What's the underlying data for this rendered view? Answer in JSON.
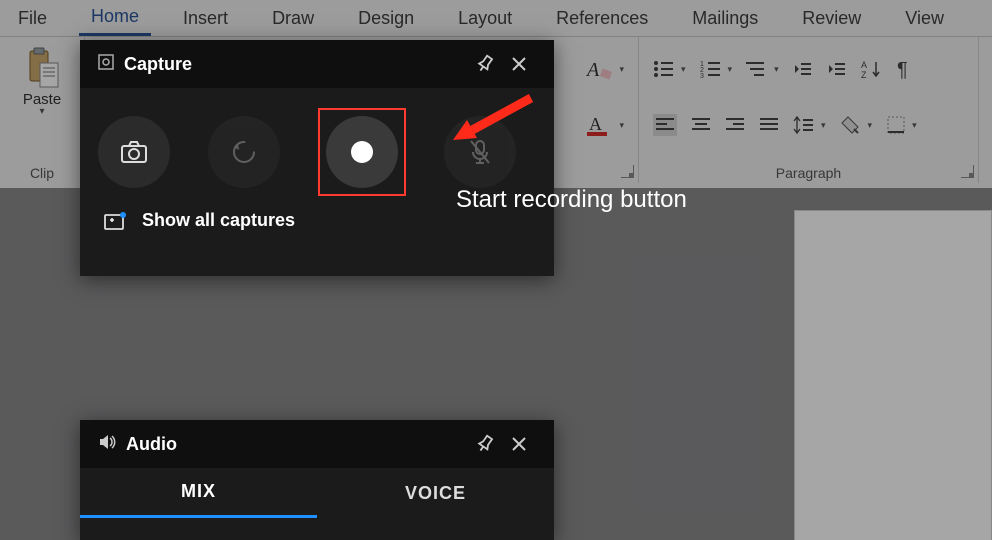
{
  "ribbon": {
    "tabs": [
      "File",
      "Home",
      "Insert",
      "Draw",
      "Design",
      "Layout",
      "References",
      "Mailings",
      "Review",
      "View"
    ],
    "active_tab": "Home",
    "paste_label": "Paste",
    "clipboard_group_label": "Clip",
    "paragraph_group_label": "Paragraph"
  },
  "capture": {
    "title": "Capture",
    "show_all_label": "Show all captures",
    "annotation": "Start recording button"
  },
  "audio": {
    "title": "Audio",
    "tabs": {
      "mix": "MIX",
      "voice": "VOICE"
    },
    "active": "MIX"
  }
}
